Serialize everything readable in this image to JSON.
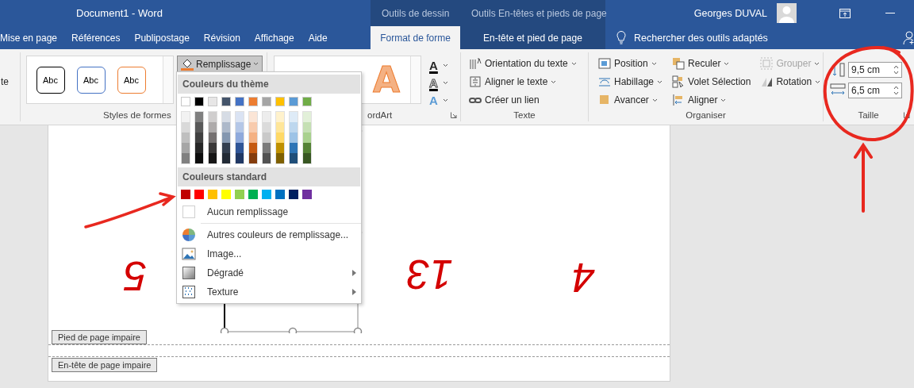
{
  "title_bar": {
    "document_title": "Document1  -  Word",
    "user_name": "Georges DUVAL"
  },
  "tabs": [
    {
      "label": "Mise en page",
      "selected": false
    },
    {
      "label": "Références",
      "selected": false
    },
    {
      "label": "Publipostage",
      "selected": false
    },
    {
      "label": "Révision",
      "selected": false
    },
    {
      "label": "Affichage",
      "selected": false
    },
    {
      "label": "Aide",
      "selected": false
    }
  ],
  "context_groups": [
    {
      "title": "Outils de dessin",
      "tabs": [
        {
          "label": "Format de forme",
          "selected": true
        }
      ]
    },
    {
      "title": "Outils En-têtes et pieds de page",
      "tabs": [
        {
          "label": "En-tête et pied de page",
          "selected": false
        }
      ]
    }
  ],
  "search": {
    "placeholder": "Rechercher des outils adaptés"
  },
  "ribbon": {
    "partial_group_text": "te",
    "shape_styles": {
      "label": "Styles de formes",
      "gallery": [
        {
          "text": "Abc",
          "color": "#000000"
        },
        {
          "text": "Abc",
          "color": "#4472c4"
        },
        {
          "text": "Abc",
          "color": "#ed7d31"
        }
      ],
      "fill_button": {
        "label": "Remplissage",
        "pressed": true
      }
    },
    "wordart": {
      "label": "ordArt",
      "gallery": [
        {
          "text": "A",
          "color": "#f4b183"
        }
      ],
      "tools": [
        {
          "kind": "fill",
          "glyph": "A"
        },
        {
          "kind": "outline",
          "glyph": "A"
        },
        {
          "kind": "effects",
          "glyph": "A"
        }
      ]
    },
    "text_group": {
      "label": "Texte",
      "items": [
        {
          "kind": "orientation",
          "label": "Orientation du texte",
          "dropdown": true
        },
        {
          "kind": "align_text",
          "label": "Aligner le texte",
          "dropdown": true
        },
        {
          "kind": "link",
          "label": "Créer un lien",
          "dropdown": false
        }
      ]
    },
    "arrange": {
      "label": "Organiser",
      "columns": [
        [
          {
            "kind": "position",
            "label": "Position",
            "dropdown": true,
            "disabled": false
          },
          {
            "kind": "wrap",
            "label": "Habillage",
            "dropdown": true,
            "disabled": false
          },
          {
            "kind": "forward",
            "label": "Avancer",
            "dropdown": true,
            "disabled": false
          }
        ],
        [
          {
            "kind": "backward",
            "label": "Reculer",
            "dropdown": true,
            "disabled": false
          },
          {
            "kind": "selection_pane",
            "label": "Volet Sélection",
            "dropdown": false,
            "disabled": false
          },
          {
            "kind": "align",
            "label": "Aligner",
            "dropdown": true,
            "disabled": false
          }
        ],
        [
          {
            "kind": "group",
            "label": "Grouper",
            "dropdown": true,
            "disabled": true
          },
          {
            "kind": "rotate",
            "label": "Rotation",
            "dropdown": true,
            "disabled": false
          }
        ]
      ]
    },
    "size": {
      "label": "Taille",
      "height": "9,5 cm",
      "width": "6,5 cm"
    }
  },
  "fill_menu": {
    "theme_heading": "Couleurs du thème",
    "theme_colors": [
      {
        "color": "#ffffff",
        "shades": [
          {
            "color": "#f2f2f2"
          },
          {
            "color": "#d9d9d9"
          },
          {
            "color": "#bfbfbf"
          },
          {
            "color": "#a6a6a6"
          },
          {
            "color": "#808080"
          }
        ]
      },
      {
        "color": "#000000",
        "shades": [
          {
            "color": "#808080"
          },
          {
            "color": "#595959"
          },
          {
            "color": "#404040"
          },
          {
            "color": "#262626"
          },
          {
            "color": "#0d0d0d"
          }
        ]
      },
      {
        "color": "#e7e6e6",
        "shades": [
          {
            "color": "#d0cece"
          },
          {
            "color": "#aeabab"
          },
          {
            "color": "#757171"
          },
          {
            "color": "#3a3838"
          },
          {
            "color": "#171616"
          }
        ]
      },
      {
        "color": "#44546a",
        "shades": [
          {
            "color": "#d6dce5"
          },
          {
            "color": "#adb9ca"
          },
          {
            "color": "#8497b0"
          },
          {
            "color": "#333f50"
          },
          {
            "color": "#222a35"
          }
        ]
      },
      {
        "color": "#4472c4",
        "shades": [
          {
            "color": "#dae3f3"
          },
          {
            "color": "#b4c7e7"
          },
          {
            "color": "#8faadc"
          },
          {
            "color": "#2f5597"
          },
          {
            "color": "#203864"
          }
        ]
      },
      {
        "color": "#ed7d31",
        "shades": [
          {
            "color": "#fbe5d6"
          },
          {
            "color": "#f8cbad"
          },
          {
            "color": "#f4b183"
          },
          {
            "color": "#c55a11"
          },
          {
            "color": "#843c0c"
          }
        ]
      },
      {
        "color": "#a5a5a5",
        "shades": [
          {
            "color": "#ededed"
          },
          {
            "color": "#dbdbdb"
          },
          {
            "color": "#c9c9c9"
          },
          {
            "color": "#7b7b7b"
          },
          {
            "color": "#525252"
          }
        ]
      },
      {
        "color": "#ffc000",
        "shades": [
          {
            "color": "#fff2cc"
          },
          {
            "color": "#ffe699"
          },
          {
            "color": "#ffd966"
          },
          {
            "color": "#bf9000"
          },
          {
            "color": "#7f6000"
          }
        ]
      },
      {
        "color": "#5b9bd5",
        "shades": [
          {
            "color": "#deebf7"
          },
          {
            "color": "#bdd7ee"
          },
          {
            "color": "#9dc3e6"
          },
          {
            "color": "#2e75b6"
          },
          {
            "color": "#1f4e79"
          }
        ]
      },
      {
        "color": "#70ad47",
        "shades": [
          {
            "color": "#e2f0d9"
          },
          {
            "color": "#c5e0b4"
          },
          {
            "color": "#a9d18e"
          },
          {
            "color": "#548235"
          },
          {
            "color": "#385723"
          }
        ]
      }
    ],
    "standard_heading": "Couleurs standard",
    "standard_colors": [
      {
        "color": "#c00000"
      },
      {
        "color": "#ff0000"
      },
      {
        "color": "#ffc000"
      },
      {
        "color": "#ffff00"
      },
      {
        "color": "#92d050"
      },
      {
        "color": "#00b050"
      },
      {
        "color": "#00b0f0"
      },
      {
        "color": "#0070c0"
      },
      {
        "color": "#002060"
      },
      {
        "color": "#7030a0"
      }
    ],
    "items": [
      {
        "kind": "no_fill",
        "label": "Aucun remplissage",
        "submenu": false
      },
      {
        "kind": "more_colors",
        "label": "Autres couleurs de remplissage...",
        "submenu": false
      },
      {
        "kind": "picture",
        "label": "Image...",
        "submenu": false
      },
      {
        "kind": "gradient",
        "label": "Dégradé",
        "submenu": true
      },
      {
        "kind": "texture",
        "label": "Texture",
        "submenu": true
      }
    ]
  },
  "document": {
    "numbers": [
      "5",
      "13",
      "4"
    ],
    "footer_label": "Pied de page impaire",
    "header_label": "En-tête de page impaire"
  }
}
